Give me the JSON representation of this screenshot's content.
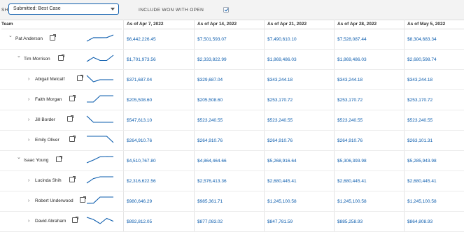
{
  "toolbar": {
    "show_label": "SHOW:",
    "selected_option": "Submitted: Best Case",
    "include_label": "INCLUDE WON WITH OPEN",
    "include_checked": true
  },
  "columns": {
    "team": "Team",
    "dates": [
      "As of Apr 7, 2022",
      "As of Apr 14, 2022",
      "As of Apr 21, 2022",
      "As of Apr 28, 2022",
      "As of May 5, 2022"
    ]
  },
  "colors": {
    "accent": "#0b5cad",
    "header_bg": "#f3f3f3"
  },
  "rows": [
    {
      "name": "Pat Anderson",
      "level": 0,
      "expanded": true,
      "trend": [
        6442226.45,
        7501593.07,
        7490610.1,
        7528087.44,
        8304683.34
      ],
      "values": [
        "$6,442,226.45",
        "$7,501,593.07",
        "$7,490,610.10",
        "$7,528,087.44",
        "$8,304,683.34"
      ]
    },
    {
      "name": "Tim Morrison",
      "level": 1,
      "expanded": true,
      "trend": [
        1701973.56,
        2333822.99,
        1869486.03,
        1869486.03,
        2680598.74
      ],
      "values": [
        "$1,701,973.56",
        "$2,333,822.99",
        "$1,869,486.03",
        "$1,869,486.03",
        "$2,680,598.74"
      ]
    },
    {
      "name": "Abigail Metcalf",
      "level": 2,
      "expanded": false,
      "trend": [
        371687.04,
        329687.04,
        343244.18,
        343244.18,
        343244.18
      ],
      "values": [
        "$371,687.04",
        "$329,687.04",
        "$343,244.18",
        "$343,244.18",
        "$343,244.18"
      ]
    },
    {
      "name": "Faith Morgan",
      "level": 2,
      "expanded": false,
      "trend": [
        205508.6,
        205508.6,
        253170.72,
        253170.72,
        253170.72
      ],
      "values": [
        "$205,508.60",
        "$205,508.60",
        "$253,170.72",
        "$253,170.72",
        "$253,170.72"
      ]
    },
    {
      "name": "Jill Border",
      "level": 2,
      "expanded": false,
      "trend": [
        547613.1,
        523240.55,
        523240.55,
        523240.55,
        523240.55
      ],
      "values": [
        "$547,613.10",
        "$523,240.55",
        "$523,240.55",
        "$523,240.55",
        "$523,240.55"
      ]
    },
    {
      "name": "Emily Oliver",
      "level": 2,
      "expanded": false,
      "trend": [
        264910.76,
        264910.76,
        264910.76,
        264910.76,
        263101.31
      ],
      "values": [
        "$264,910.76",
        "$264,910.76",
        "$264,910.76",
        "$264,910.76",
        "$263,101.31"
      ]
    },
    {
      "name": "Isaac Young",
      "level": 1,
      "expanded": true,
      "trend": [
        4510767.8,
        4864464.66,
        5268916.64,
        5306393.98,
        5285943.98
      ],
      "values": [
        "$4,510,767.80",
        "$4,864,464.66",
        "$5,268,916.64",
        "$5,306,393.98",
        "$5,285,943.98"
      ]
    },
    {
      "name": "Lucinda Shih",
      "level": 2,
      "expanded": false,
      "trend": [
        2316622.56,
        2576413.36,
        2680445.41,
        2680445.41,
        2680445.41
      ],
      "values": [
        "$2,316,622.56",
        "$2,576,413.36",
        "$2,680,445.41",
        "$2,680,445.41",
        "$2,680,445.41"
      ]
    },
    {
      "name": "Robert Underwood",
      "level": 2,
      "expanded": false,
      "trend": [
        980646.29,
        985361.71,
        1245100.58,
        1245100.58,
        1245100.58
      ],
      "values": [
        "$980,646.29",
        "$985,361.71",
        "$1,245,100.58",
        "$1,245,100.58",
        "$1,245,100.58"
      ]
    },
    {
      "name": "David Abraham",
      "level": 2,
      "expanded": false,
      "trend": [
        892812.05,
        877083.02,
        847781.59,
        885258.93,
        864808.93
      ],
      "values": [
        "$892,812.05",
        "$877,083.02",
        "$847,781.59",
        "$885,258.93",
        "$864,808.93"
      ]
    }
  ]
}
